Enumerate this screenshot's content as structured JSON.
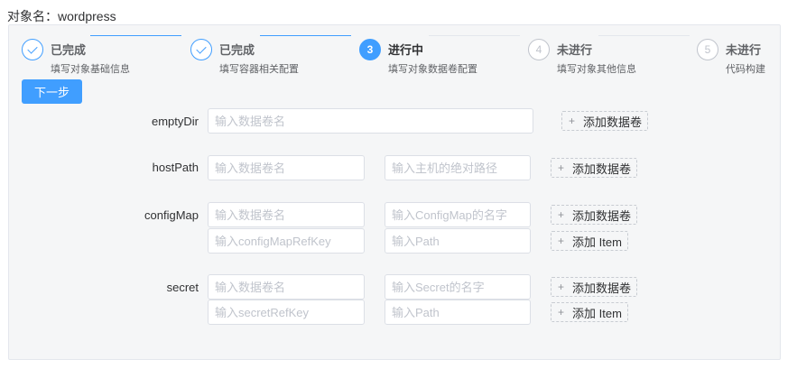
{
  "header": {
    "object_label": "对象名：",
    "object_name": "wordpress"
  },
  "steps": [
    {
      "title": "已完成",
      "desc": "填写对象基础信息",
      "status": "finish",
      "number": "1"
    },
    {
      "title": "已完成",
      "desc": "填写容器相关配置",
      "status": "finish",
      "number": "2"
    },
    {
      "title": "进行中",
      "desc": "填写对象数据卷配置",
      "status": "process",
      "number": "3"
    },
    {
      "title": "未进行",
      "desc": "填写对象其他信息",
      "status": "wait",
      "number": "4"
    },
    {
      "title": "未进行",
      "desc": "代码构建",
      "status": "wait",
      "number": "5"
    }
  ],
  "next_button": "下一步",
  "volumes": {
    "emptydir": {
      "label": "emptyDir",
      "name_placeholder": "输入数据卷名",
      "add_label": "添加数据卷"
    },
    "hostpath": {
      "label": "hostPath",
      "name_placeholder": "输入数据卷名",
      "path_placeholder": "输入主机的绝对路径",
      "add_label": "添加数据卷"
    },
    "configmap": {
      "label": "configMap",
      "name_placeholder": "输入数据卷名",
      "cm_name_placeholder": "输入ConfigMap的名字",
      "add_label": "添加数据卷",
      "refkey_placeholder": "输入configMapRefKey",
      "path_placeholder": "输入Path",
      "add_item_label": "添加 Item"
    },
    "secret": {
      "label": "secret",
      "name_placeholder": "输入数据卷名",
      "secret_name_placeholder": "输入Secret的名字",
      "add_label": "添加数据卷",
      "refkey_placeholder": "输入secretRefKey",
      "path_placeholder": "输入Path",
      "add_item_label": "添加 Item"
    }
  },
  "colors": {
    "primary": "#409eff",
    "panel_bg": "#f5f6f7",
    "placeholder": "#c0c4cc"
  }
}
